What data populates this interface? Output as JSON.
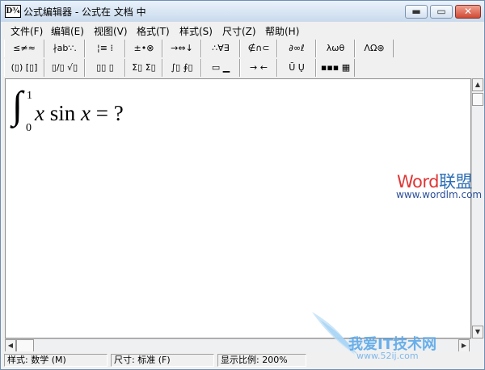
{
  "window": {
    "title": "公式编辑器 - 公式在 文档  中",
    "icon_text": "D¾"
  },
  "controls": {
    "minimize": "▬",
    "maximize": "▭",
    "close": "✕"
  },
  "menu": [
    "文件(F)",
    "编辑(E)",
    "视图(V)",
    "格式(T)",
    "样式(S)",
    "尺寸(Z)",
    "帮助(H)"
  ],
  "toolbar_row1": [
    "≤≠≈",
    "∤ab∵.",
    "¦≡ ⁞",
    "±•⊗",
    "→⇔↓",
    "∴∀∃",
    "∉∩⊂",
    "∂∞ℓ",
    "λωθ",
    "ΛΩ⊛"
  ],
  "toolbar_row2": [
    "(▯) [▯]",
    "▯/▯ √▯",
    "▯▯ ▯",
    "Σ▯ Σ▯",
    "∫▯ ∮▯",
    "▭ ▁",
    "→ ←",
    "Ū Ų",
    "▪▪▪ ▦"
  ],
  "formula": {
    "integral": "∫",
    "upper": "1",
    "lower": "0",
    "var": "x",
    "func": " sin ",
    "var2": "x",
    "rest": " = ?"
  },
  "statusbar": {
    "style": "样式: 数学 (M)",
    "size": "尺寸: 标准 (F)",
    "zoom": "显示比例: 200%"
  },
  "watermark": {
    "brand_a": "Word",
    "brand_b": "联盟",
    "url": "www.wordlm.com",
    "site": "我爱IT技术网",
    "site_url": "www.52ij.com"
  }
}
